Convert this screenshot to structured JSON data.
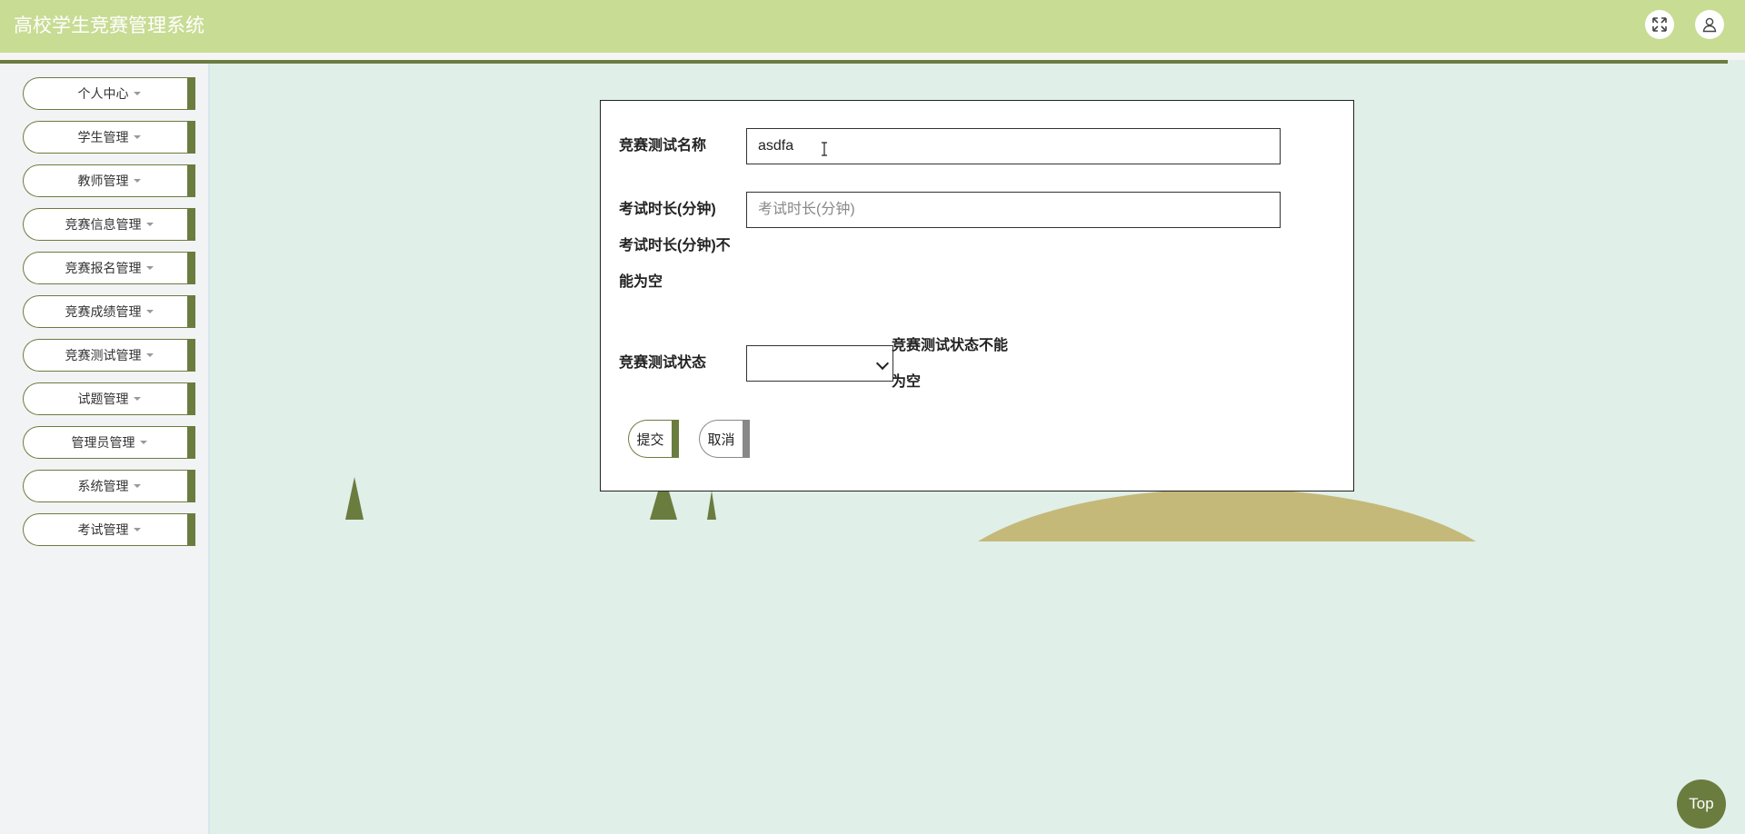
{
  "header": {
    "title": "高校学生竞赛管理系统",
    "fullscreen_icon": "fullscreen-icon",
    "user_icon": "user-icon"
  },
  "sidebar": {
    "items": [
      {
        "label": "个人中心"
      },
      {
        "label": "学生管理"
      },
      {
        "label": "教师管理"
      },
      {
        "label": "竞赛信息管理"
      },
      {
        "label": "竞赛报名管理"
      },
      {
        "label": "竞赛成绩管理"
      },
      {
        "label": "竞赛测试管理"
      },
      {
        "label": "试题管理"
      },
      {
        "label": "管理员管理"
      },
      {
        "label": "系统管理"
      },
      {
        "label": "考试管理"
      }
    ]
  },
  "form": {
    "name_label": "竞赛测试名称",
    "name_value": "asdfa",
    "duration_label": "考试时长(分钟)",
    "duration_placeholder": "考试时长(分钟)",
    "duration_error_line1": "考试时长(分钟)不",
    "duration_error_line2": "能为空",
    "status_label": "竞赛测试状态",
    "status_value": "",
    "status_error_line1": "竞赛测试状态不能",
    "status_error_line2": "为空",
    "submit_label": "提交",
    "cancel_label": "取消"
  },
  "top_button": "Top",
  "colors": {
    "header_bg": "#c8dc94",
    "accent": "#6b7c3f",
    "page_bg": "#e0efe8",
    "hill": "#c5b97a"
  }
}
